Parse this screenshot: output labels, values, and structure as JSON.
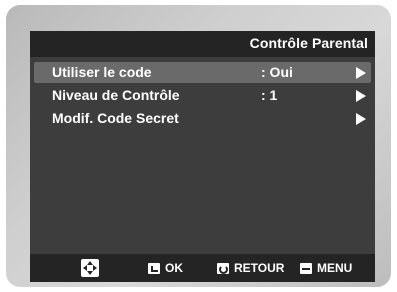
{
  "header": {
    "title": "Contrôle Parental"
  },
  "menu": {
    "items": [
      {
        "label": "Utiliser le code",
        "value": ": Oui",
        "selected": true
      },
      {
        "label": "Niveau de Contrôle",
        "value": ": 1",
        "selected": false
      },
      {
        "label": "Modif. Code Secret",
        "value": "",
        "selected": false
      }
    ]
  },
  "footer": {
    "nav_icon": "dpad-icon",
    "ok_icon": "enter-icon",
    "ok_label": "OK",
    "return_icon": "return-icon",
    "return_label": "RETOUR",
    "menu_icon": "menu-icon",
    "menu_label": "MENU"
  },
  "colors": {
    "screen_bg": "#3d3d3d",
    "bar_bg": "#242424",
    "highlight": "#6a6a6a",
    "text": "#ffffff"
  }
}
